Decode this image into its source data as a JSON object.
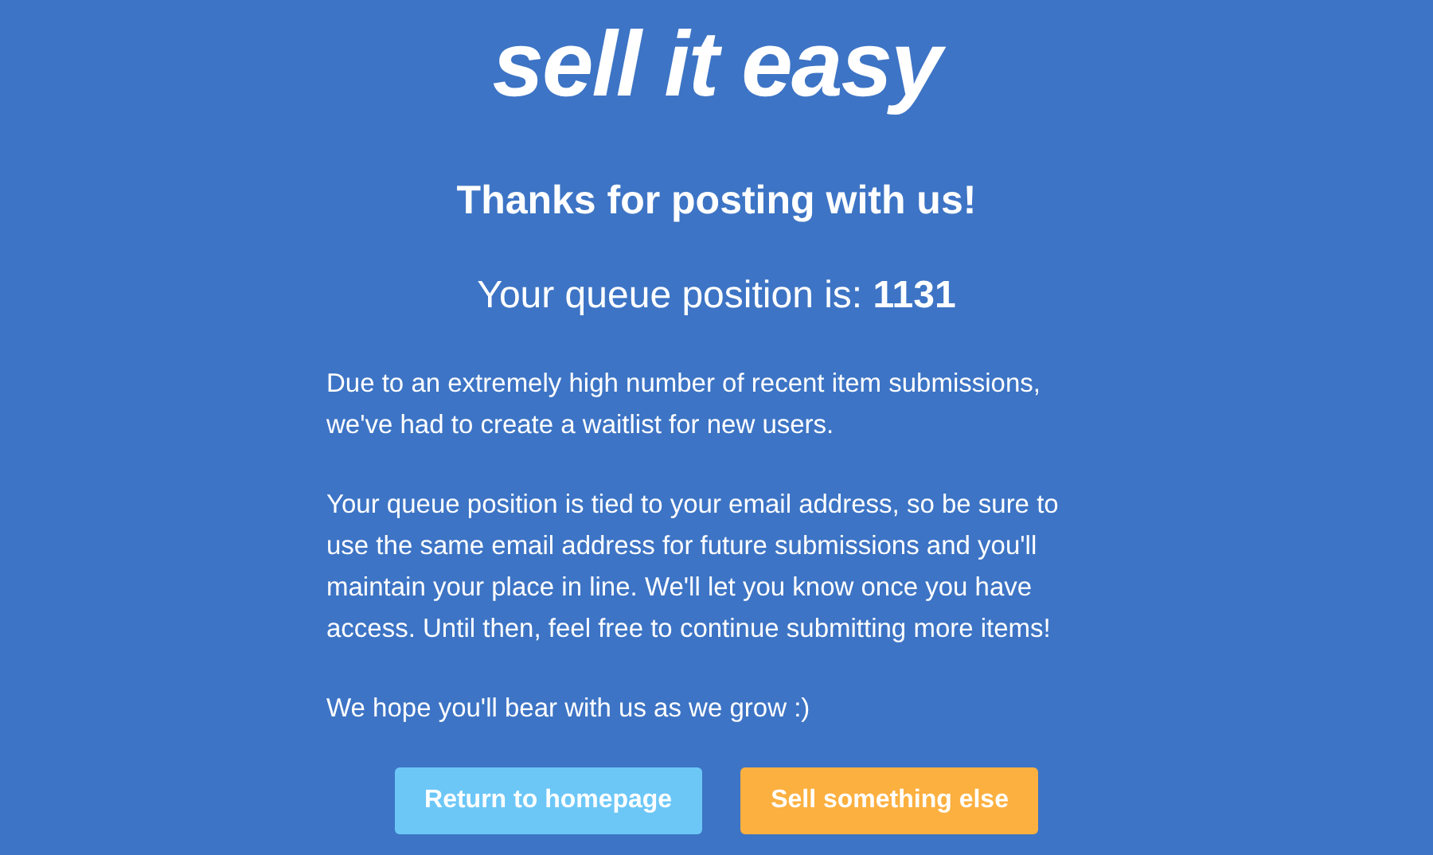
{
  "logo": "sell it easy",
  "heading": "Thanks for posting with us!",
  "queue_line": "Your queue position is: **1131**",
  "paragraphs": [
    "Due to an extremely high number of recent item submissions, we've had to create a waitlist for new users.",
    "Your queue position is tied to your email address, so be sure to use the same email address for future submissions and you'll maintain your place in line. We'll let you know once you have access. Until then, feel free to continue submitting more items!",
    "We hope you'll bear with us as we grow :)"
  ],
  "buttons": [
    {
      "label": "Return to homepage",
      "kind": "secondary"
    },
    {
      "label": "Sell something else",
      "kind": "primary"
    }
  ]
}
